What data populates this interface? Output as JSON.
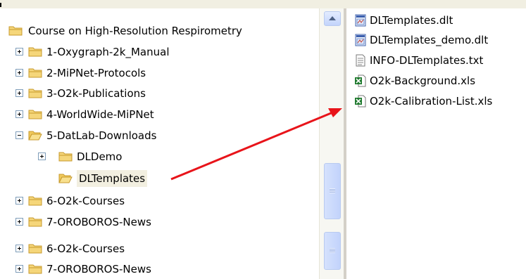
{
  "tree": {
    "root_label": "Course on High-Resolution Respirometry",
    "items": [
      {
        "label": "1-Oxygraph-2k_Manual",
        "expander": "+"
      },
      {
        "label": "2-MiPNet-Protocols",
        "expander": "+"
      },
      {
        "label": "3-O2k-Publications",
        "expander": "+"
      },
      {
        "label": "4-WorldWide-MiPNet",
        "expander": "+"
      },
      {
        "label": "5-DatLab-Downloads",
        "expander": "−"
      },
      {
        "label": "DLDemo",
        "expander": "+"
      },
      {
        "label": "DLTemplates",
        "expander": ""
      },
      {
        "label": "6-O2k-Courses",
        "expander": "+"
      },
      {
        "label": "7-OROBOROS-News",
        "expander": "+"
      },
      {
        "label": "6-O2k-Courses",
        "expander": "+"
      },
      {
        "label": "7-OROBOROS-News",
        "expander": "+"
      }
    ],
    "selected_item": "DLTemplates"
  },
  "files": [
    {
      "name": "DLTemplates.dlt",
      "icon": "dlt-file-icon"
    },
    {
      "name": "DLTemplates_demo.dlt",
      "icon": "dlt-file-icon"
    },
    {
      "name": "INFO-DLTemplates.txt",
      "icon": "text-file-icon"
    },
    {
      "name": "O2k-Background.xls",
      "icon": "excel-file-icon"
    },
    {
      "name": "O2k-Calibration-List.xls",
      "icon": "excel-file-icon"
    }
  ],
  "colors": {
    "folder": "#f5d67a",
    "folder_edge": "#c79a2c",
    "arrow": "#e8141a",
    "excel": "#1f7a2e",
    "selection": "#f2efe0"
  }
}
